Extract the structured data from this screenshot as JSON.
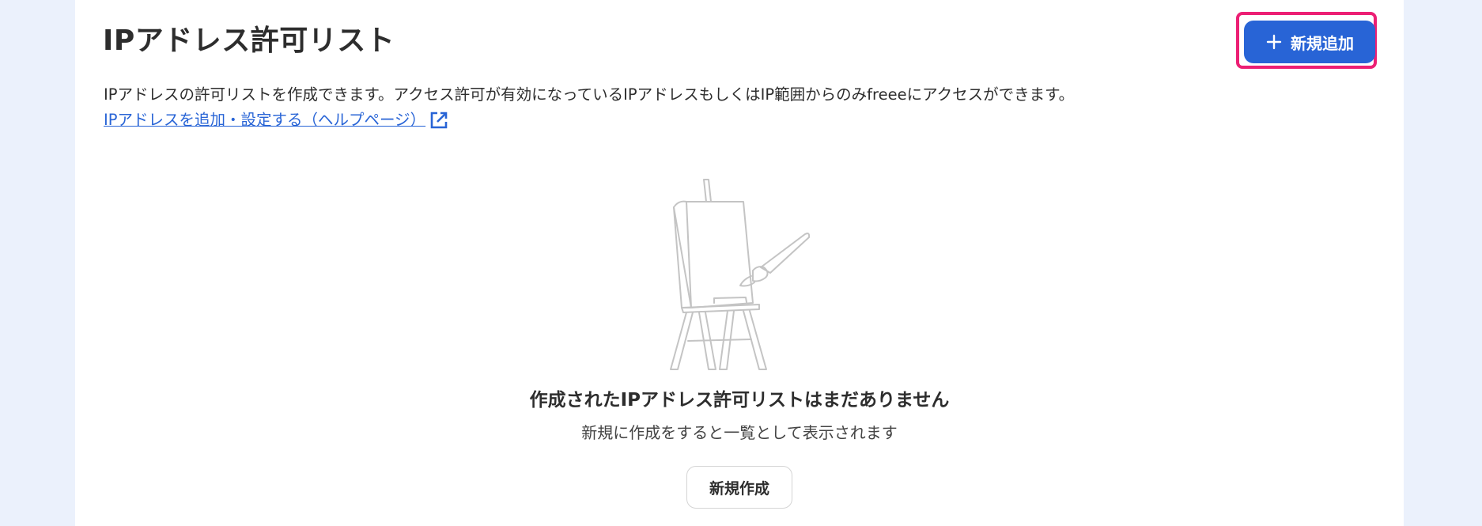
{
  "page": {
    "title": "IPアドレス許可リスト",
    "description": "IPアドレスの許可リストを作成できます。アクセス許可が有効になっているIPアドレスもしくはIP範囲からのみfreeeにアクセスができます。",
    "help_link_label": "IPアドレスを追加・設定する（ヘルプページ）"
  },
  "toolbar": {
    "add_button_label": "新規追加",
    "add_button_icon": "plus-icon"
  },
  "empty_state": {
    "title": "作成されたIPアドレス許可リストはまだありません",
    "subtitle": "新規に作成をすると一覧として表示されます",
    "create_button_label": "新規作成",
    "illustration": "easel-with-paintbrush"
  },
  "colors": {
    "background": "#ebf1fc",
    "panel": "#ffffff",
    "primary": "#2864d6",
    "link": "#2864d6",
    "highlight": "#ec1f74",
    "text": "#2d2d2d"
  }
}
